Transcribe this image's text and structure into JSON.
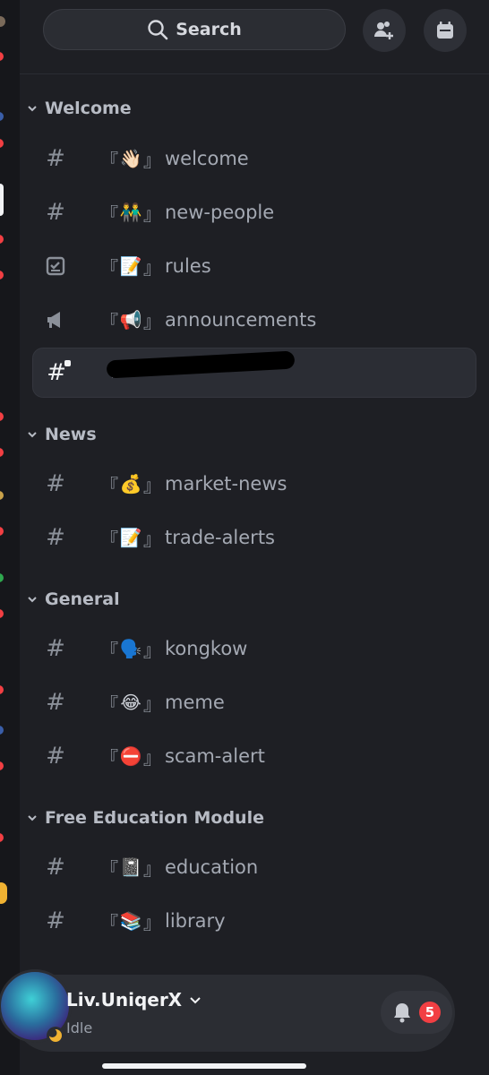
{
  "header": {
    "search_label": "Search",
    "invite_icon": "add-member-icon",
    "events_icon": "calendar-icon"
  },
  "categories": [
    {
      "label": "Welcome",
      "channels": [
        {
          "name": "welcome",
          "emoji": "👋🏻",
          "icon": "hash-icon"
        },
        {
          "name": "new-people",
          "emoji": "👬",
          "icon": "hash-icon"
        },
        {
          "name": "rules",
          "emoji": "📝",
          "icon": "rules-checkbox-icon"
        },
        {
          "name": "announcements",
          "emoji": "📢",
          "icon": "megaphone-icon"
        },
        {
          "name": "",
          "emoji": "",
          "icon": "locked-hash-icon",
          "active": true,
          "redacted": true
        }
      ]
    },
    {
      "label": "News",
      "channels": [
        {
          "name": "market-news",
          "emoji": "💰",
          "icon": "hash-icon"
        },
        {
          "name": "trade-alerts",
          "emoji": "📝",
          "icon": "hash-icon"
        }
      ]
    },
    {
      "label": "General",
      "channels": [
        {
          "name": "kongkow",
          "emoji": "🗣️",
          "icon": "hash-icon"
        },
        {
          "name": "meme",
          "emoji": "😂",
          "icon": "hash-icon"
        },
        {
          "name": "scam-alert",
          "emoji": "⛔",
          "icon": "hash-icon"
        }
      ]
    },
    {
      "label": "Free Education Module",
      "channels": [
        {
          "name": "education",
          "emoji": "📓",
          "icon": "hash-icon"
        },
        {
          "name": "library",
          "emoji": "📚",
          "icon": "hash-icon"
        }
      ]
    }
  ],
  "brackets": {
    "open": "『",
    "close": "』"
  },
  "user": {
    "name": "Liv.UniqerX",
    "status": "Idle",
    "notifications": "5"
  },
  "colors": {
    "background": "#1e1f24",
    "accent_red": "#f23f43",
    "idle": "#f0b232"
  }
}
